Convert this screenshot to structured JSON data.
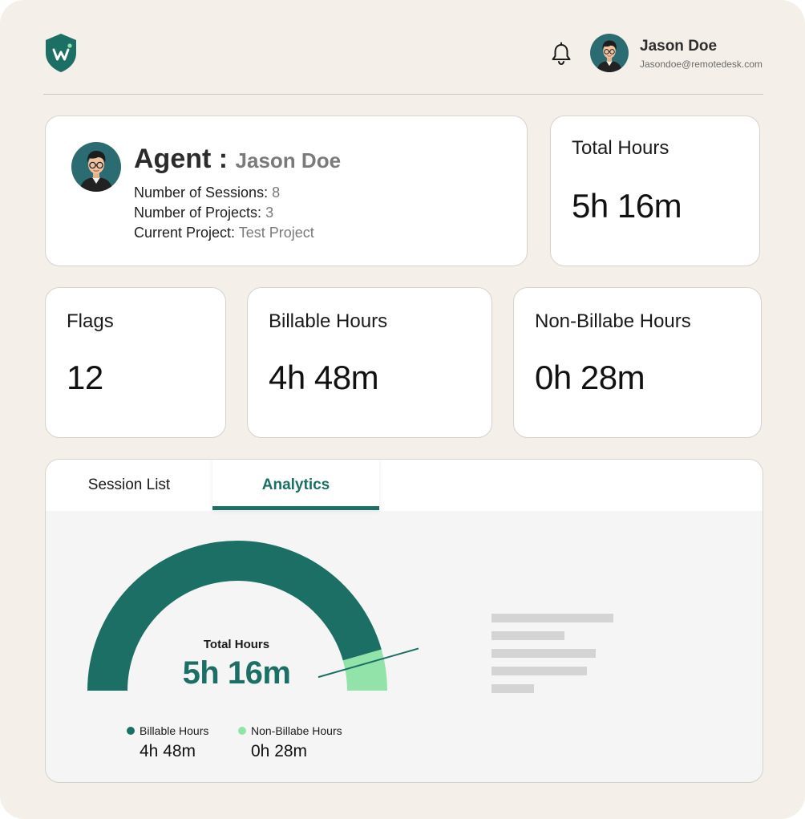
{
  "header": {
    "logo_icon": "shield-w-logo-icon",
    "notification_icon": "bell-icon",
    "user_name": "Jason Doe",
    "user_email": "Jasondoe@remotedesk.com"
  },
  "agent": {
    "title_prefix": "Agent :",
    "name": "Jason Doe",
    "sessions_label": "Number of Sessions:",
    "sessions_value": "8",
    "projects_label": "Number of Projects:",
    "projects_value": "3",
    "current_project_label": "Current Project:",
    "current_project_value": "Test Project"
  },
  "stats": {
    "total_hours": {
      "label": "Total Hours",
      "value": "5h 16m"
    },
    "flags": {
      "label": "Flags",
      "value": "12"
    },
    "billable": {
      "label": "Billable Hours",
      "value": "4h 48m"
    },
    "non_billable": {
      "label": "Non-Billabe Hours",
      "value": "0h 28m"
    }
  },
  "tabs": [
    {
      "label": "Session List",
      "active": false
    },
    {
      "label": "Analytics",
      "active": true
    }
  ],
  "colors": {
    "primary": "#1b6f64",
    "accent_light": "#92e3a9",
    "background": "#f4efe9"
  },
  "chart_data": {
    "type": "pie",
    "title": "Total Hours",
    "center_value": "5h 16m",
    "categories": [
      "Billable Hours",
      "Non-Billabe Hours"
    ],
    "values": [
      288,
      28
    ],
    "value_labels": [
      "4h 48m",
      "0h 28m"
    ],
    "colors": [
      "#1b6f64",
      "#92e3a9"
    ],
    "legend_placement": "bottom"
  }
}
